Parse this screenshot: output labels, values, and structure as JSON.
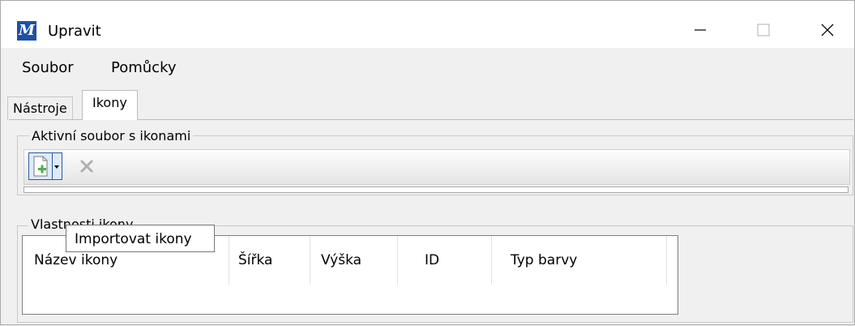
{
  "window": {
    "title": "Upravit"
  },
  "menu": {
    "items": [
      "Soubor",
      "Pomůcky"
    ]
  },
  "tabs": {
    "inactive": "Nástroje",
    "active": "Ikony"
  },
  "active_file": {
    "group_label": "Aktivní soubor s ikonami"
  },
  "properties": {
    "group_label": "Vlastnosti ikony",
    "columns": [
      "Název ikony",
      "Šířka",
      "Výška",
      "ID",
      "Typ barvy"
    ]
  },
  "tooltip": {
    "text": "Importovat ikony"
  },
  "colors": {
    "app_icon_bg": "#1e50a8",
    "add_icon_green": "#4caf50",
    "remove_gray": "#b0b0b0"
  },
  "icons": {
    "app": "app-logo-icon",
    "add": "add-file-icon",
    "remove": "delete-x-icon"
  }
}
